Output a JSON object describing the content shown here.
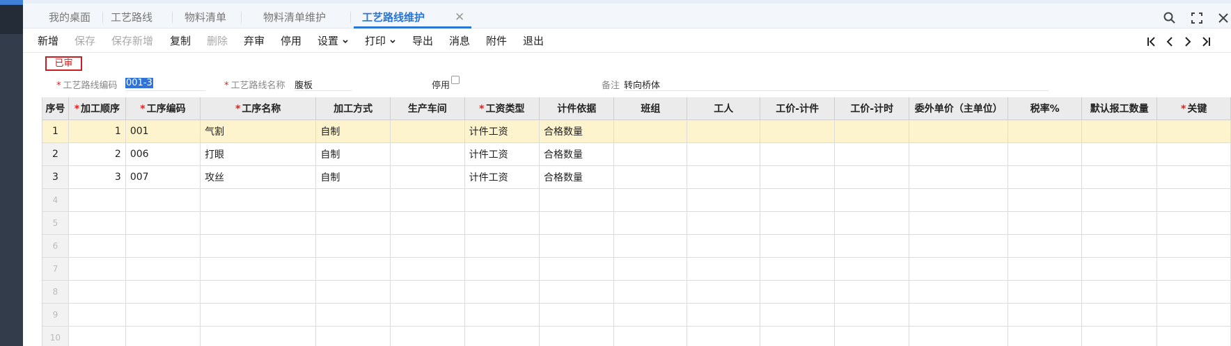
{
  "tabs": [
    {
      "label": "我的桌面",
      "active": false
    },
    {
      "label": "工艺路线",
      "active": false
    },
    {
      "label": "物料清单",
      "active": false
    },
    {
      "label": "物料清单维护",
      "active": false
    },
    {
      "label": "工艺路线维护",
      "active": true
    }
  ],
  "toolbar": {
    "new": "新增",
    "save": "保存",
    "save_new": "保存新增",
    "copy": "复制",
    "delete": "删除",
    "abandon": "弃审",
    "disable": "停用",
    "settings": "设置",
    "print": "打印",
    "export": "导出",
    "message": "消息",
    "attachment": "附件",
    "exit": "退出"
  },
  "status_badge": "已审",
  "form": {
    "code_label": "工艺路线编码",
    "code_value": "001-3",
    "name_label": "工艺路线名称",
    "name_value": "腹板",
    "disabled_label": "停用",
    "disabled_checked": false,
    "remark_label": "备注",
    "remark_value": "转向桥体"
  },
  "grid": {
    "columns": [
      "序号",
      "加工顺序",
      "工序编码",
      "工序名称",
      "加工方式",
      "生产车间",
      "工资类型",
      "计件依据",
      "班组",
      "工人",
      "工价-计件",
      "工价-计时",
      "委外单价（主单位）",
      "税率%",
      "默认报工数量",
      "关键"
    ],
    "required_columns": [
      1,
      2,
      3,
      6,
      15
    ],
    "rows": [
      {
        "seq": "1",
        "order": "1",
        "code": "001",
        "name": "气割",
        "method": "自制",
        "workshop": "",
        "wage_type": "计件工资",
        "basis": "合格数量",
        "selected": true
      },
      {
        "seq": "2",
        "order": "2",
        "code": "006",
        "name": "打眼",
        "method": "自制",
        "workshop": "",
        "wage_type": "计件工资",
        "basis": "合格数量",
        "selected": false
      },
      {
        "seq": "3",
        "order": "3",
        "code": "007",
        "name": "攻丝",
        "method": "自制",
        "workshop": "",
        "wage_type": "计件工资",
        "basis": "合格数量",
        "selected": false
      }
    ],
    "empty_rows": [
      "4",
      "5",
      "6",
      "7",
      "8",
      "9",
      "10"
    ]
  },
  "colors": {
    "accent": "#2a76d2",
    "status_red": "#c81e1e",
    "selected_row": "#fdf3cc",
    "sidebar": "#333c4a"
  }
}
